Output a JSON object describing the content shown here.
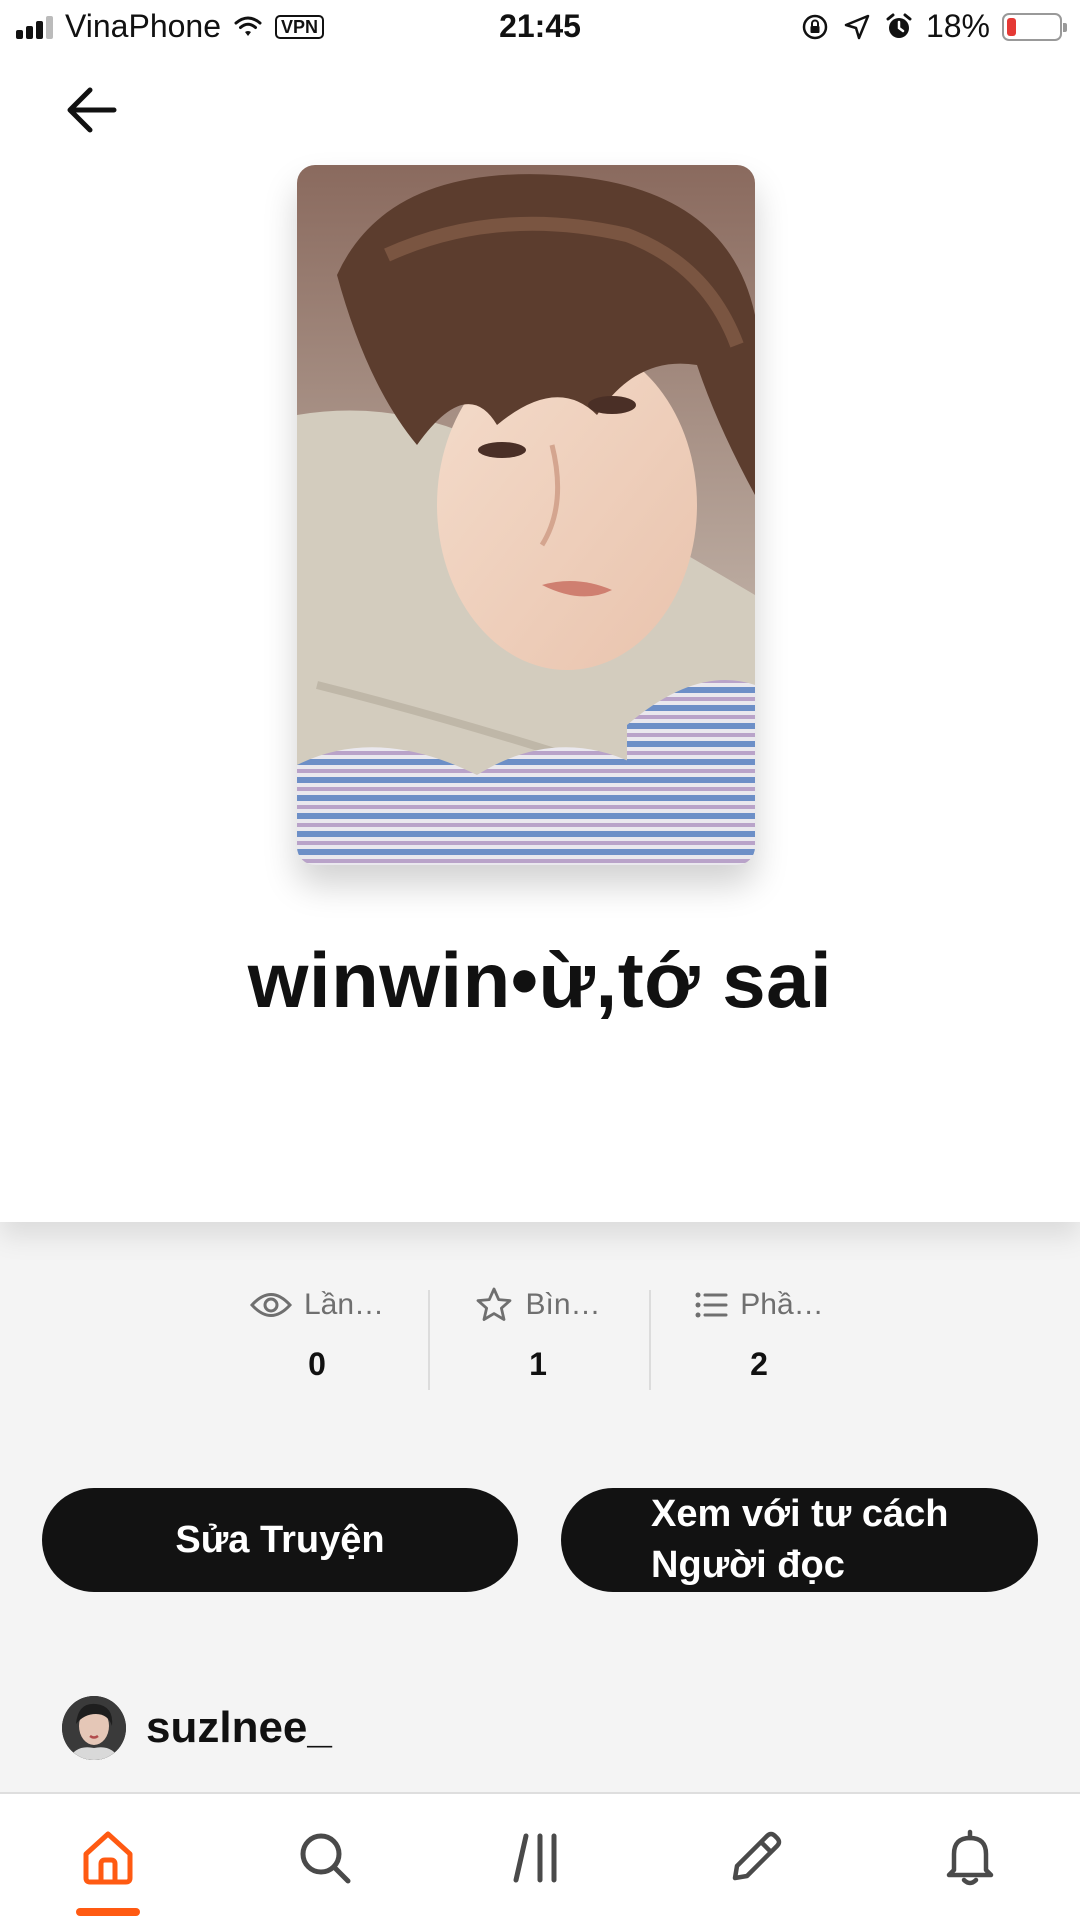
{
  "status_bar": {
    "carrier": "VinaPhone",
    "vpn": "VPN",
    "time": "21:45",
    "battery": "18%",
    "battery_level": 0.18,
    "battery_color": "#e53935"
  },
  "navigation": {
    "back_icon": "arrow-left-icon"
  },
  "story": {
    "title": "winwin•ừ,tớ sai",
    "cover_icon": "cover-image"
  },
  "stats": [
    {
      "icon": "eye-icon",
      "label": "Lần…",
      "value": "0"
    },
    {
      "icon": "star-icon",
      "label": "Bìn…",
      "value": "1"
    },
    {
      "icon": "list-icon",
      "label": "Phầ…",
      "value": "2"
    }
  ],
  "actions": {
    "edit_label": "Sửa Truyện",
    "reader_line1": "Xem với tư cách",
    "reader_line2": "Người đọc"
  },
  "author": {
    "username": "suzlnee_"
  },
  "bottom_nav": {
    "items": [
      "home-icon",
      "search-icon",
      "library-icon",
      "write-icon",
      "notifications-icon"
    ],
    "active": "home-icon",
    "accent_color": "#ff5a12",
    "inactive_color": "#4a4a4a"
  }
}
